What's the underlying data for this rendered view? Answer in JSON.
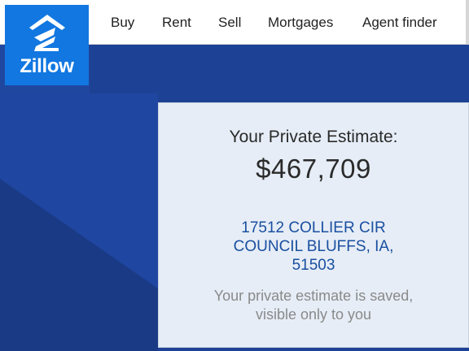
{
  "header": {
    "logo_text": "Zillow",
    "nav": [
      "Buy",
      "Rent",
      "Sell",
      "Mortgages",
      "Agent finder"
    ]
  },
  "estimate": {
    "title": "Your Private Estimate:",
    "value": "$467,709",
    "address_line1": "17512 COLLIER CIR",
    "address_line2": "COUNCIL BLUFFS, IA,",
    "address_line3": "51503",
    "note_line1": "Your private estimate is saved,",
    "note_line2": "visible only to you"
  },
  "colors": {
    "brand": "#1277e1",
    "hero_background": "#1d4295",
    "address_link": "#1a4fa0"
  },
  "icons": [
    "zillow-logo-icon"
  ]
}
